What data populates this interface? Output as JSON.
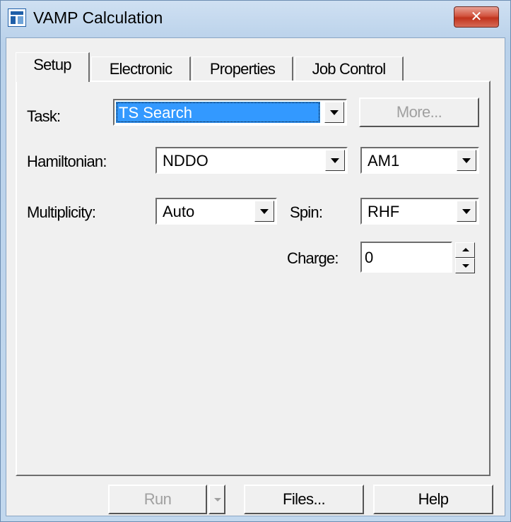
{
  "window": {
    "title": "VAMP Calculation",
    "close_label": "✕"
  },
  "tabs": [
    {
      "label": "Setup",
      "active": true
    },
    {
      "label": "Electronic",
      "active": false
    },
    {
      "label": "Properties",
      "active": false
    },
    {
      "label": "Job Control",
      "active": false
    }
  ],
  "setup": {
    "task_label": "Task:",
    "task_value": "TS Search",
    "more_label": "More...",
    "hamiltonian_label": "Hamiltonian:",
    "hamiltonian_value": "NDDO",
    "method_value": "AM1",
    "multiplicity_label": "Multiplicity:",
    "multiplicity_value": "Auto",
    "spin_label": "Spin:",
    "spin_value": "RHF",
    "charge_label": "Charge:",
    "charge_value": "0"
  },
  "buttons": {
    "run_label": "Run",
    "files_label": "Files...",
    "help_label": "Help"
  }
}
